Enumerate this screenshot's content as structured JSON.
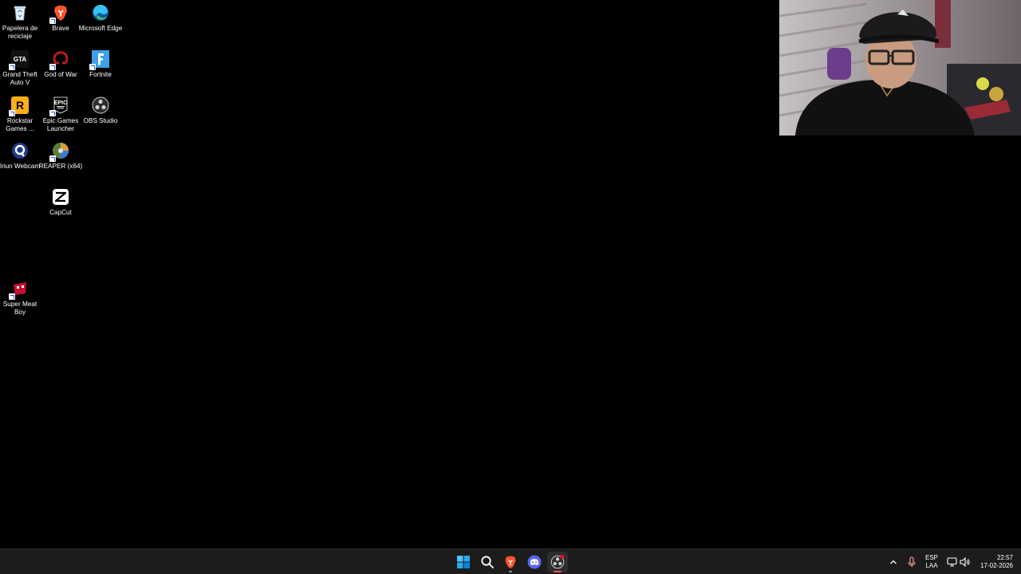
{
  "desktop": {
    "icons": [
      {
        "label": "Papelera de reciclaje",
        "icon": "recycle-bin-icon"
      },
      {
        "label": "Brave",
        "icon": "brave-icon"
      },
      {
        "label": "Microsoft Edge",
        "icon": "edge-icon"
      },
      {
        "label": "Grand Theft Auto V",
        "icon": "gta-icon"
      },
      {
        "label": "God of War",
        "icon": "god-of-war-icon"
      },
      {
        "label": "Fortnite",
        "icon": "fortnite-icon"
      },
      {
        "label": "Rockstar Games ...",
        "icon": "rockstar-icon"
      },
      {
        "label": "Epic Games Launcher",
        "icon": "epic-games-icon"
      },
      {
        "label": "OBS Studio",
        "icon": "obs-icon"
      },
      {
        "label": "Iriun Webcam",
        "icon": "iriun-icon"
      },
      {
        "label": "REAPER (x64)",
        "icon": "reaper-icon"
      },
      {
        "label": "CapCut",
        "icon": "capcut-icon"
      },
      {
        "label": "Super Meat Boy",
        "icon": "super-meat-boy-icon"
      }
    ],
    "icon_glyphs": {
      "gta": "GTA",
      "epic": "EPIC",
      "rockstar": "R"
    }
  },
  "taskbar": {
    "apps": [
      "windows-start-icon",
      "search-icon",
      "brave-icon",
      "discord-icon",
      "obs-icon"
    ],
    "tray": {
      "language_line1": "ESP",
      "language_line2": "LAA",
      "time": "22:57",
      "date": "17-02-2026"
    }
  },
  "colors": {
    "desktop_bg": "#000000",
    "taskbar_bg": "#1c1c1c",
    "brave": "#fb542b",
    "discord": "#5865f2",
    "windows_blue": "#0078d4"
  }
}
